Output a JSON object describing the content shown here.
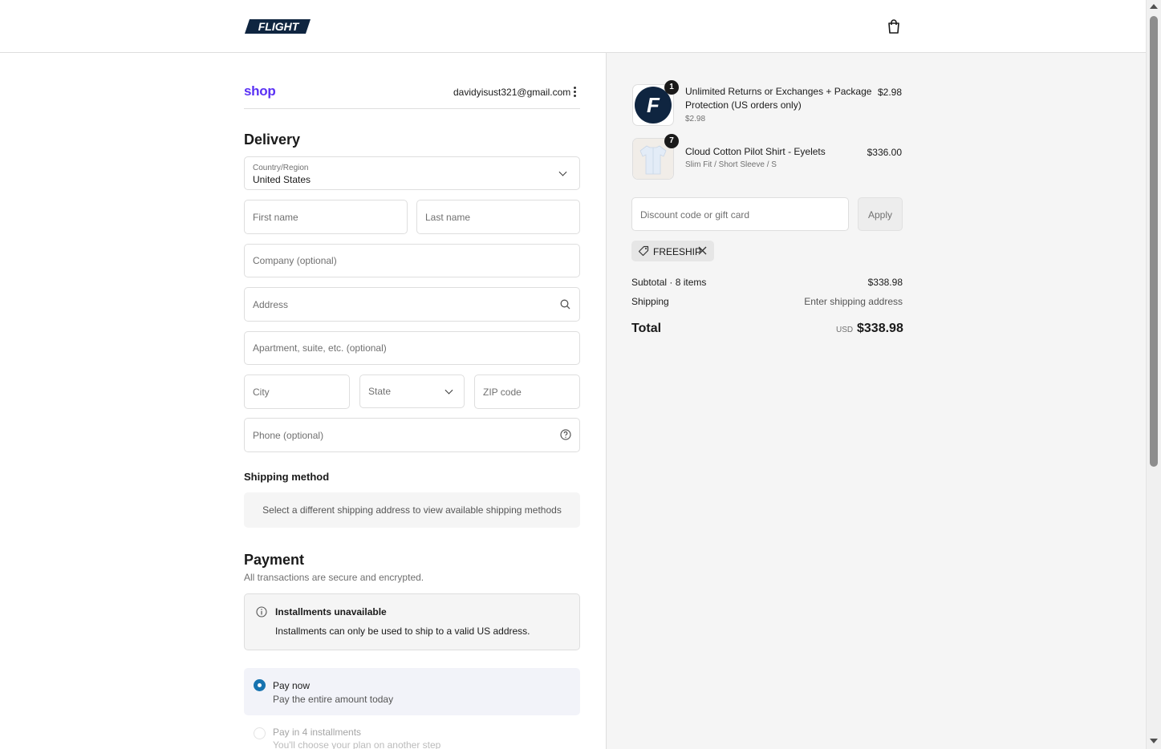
{
  "header": {
    "logo_text": "FLIGHT",
    "cart_icon": "shopping-bag-icon"
  },
  "account": {
    "shop_label": "shop",
    "email": "davidyisust321@gmail.com",
    "menu_icon": "kebab-menu-icon"
  },
  "delivery": {
    "title": "Delivery",
    "country_label": "Country/Region",
    "country_value": "United States",
    "first_name_placeholder": "First name",
    "last_name_placeholder": "Last name",
    "company_placeholder": "Company (optional)",
    "address_placeholder": "Address",
    "apartment_placeholder": "Apartment, suite, etc. (optional)",
    "city_placeholder": "City",
    "state_placeholder": "State",
    "zip_placeholder": "ZIP code",
    "phone_placeholder": "Phone (optional)"
  },
  "shipping_method": {
    "title": "Shipping method",
    "message": "Select a different shipping address to view available shipping methods"
  },
  "payment": {
    "title": "Payment",
    "subtitle": "All transactions are secure and encrypted.",
    "notice_title": "Installments unavailable",
    "notice_text": "Installments can only be used to ship to a valid US address.",
    "options": [
      {
        "title": "Pay now",
        "desc": "Pay the entire amount today",
        "selected": true
      },
      {
        "title": "Pay in 4 installments",
        "desc": "You'll choose your plan on another step",
        "selected": false
      }
    ]
  },
  "order": {
    "items": [
      {
        "qty": "1",
        "title_line1": "Unlimited Returns or Exchanges + Package",
        "title_line2": "Protection (US orders only)",
        "sub": "$2.98",
        "price": "$2.98"
      },
      {
        "qty": "7",
        "title_line1": "Cloud Cotton Pilot Shirt - Eyelets",
        "title_line2": "",
        "sub": "Slim Fit / Short Sleeve / S",
        "price": "$336.00"
      }
    ],
    "discount_placeholder": "Discount code or gift card",
    "apply_label": "Apply",
    "applied_code": "FREESHIP",
    "subtotal_label": "Subtotal · 8 items",
    "subtotal_value": "$338.98",
    "shipping_label": "Shipping",
    "shipping_value": "Enter shipping address",
    "total_label": "Total",
    "currency": "USD",
    "total_value": "$338.98"
  },
  "colors": {
    "accent": "#1773b0",
    "shop_purple": "#5a31f4",
    "panel_bg": "#f5f5f5"
  }
}
